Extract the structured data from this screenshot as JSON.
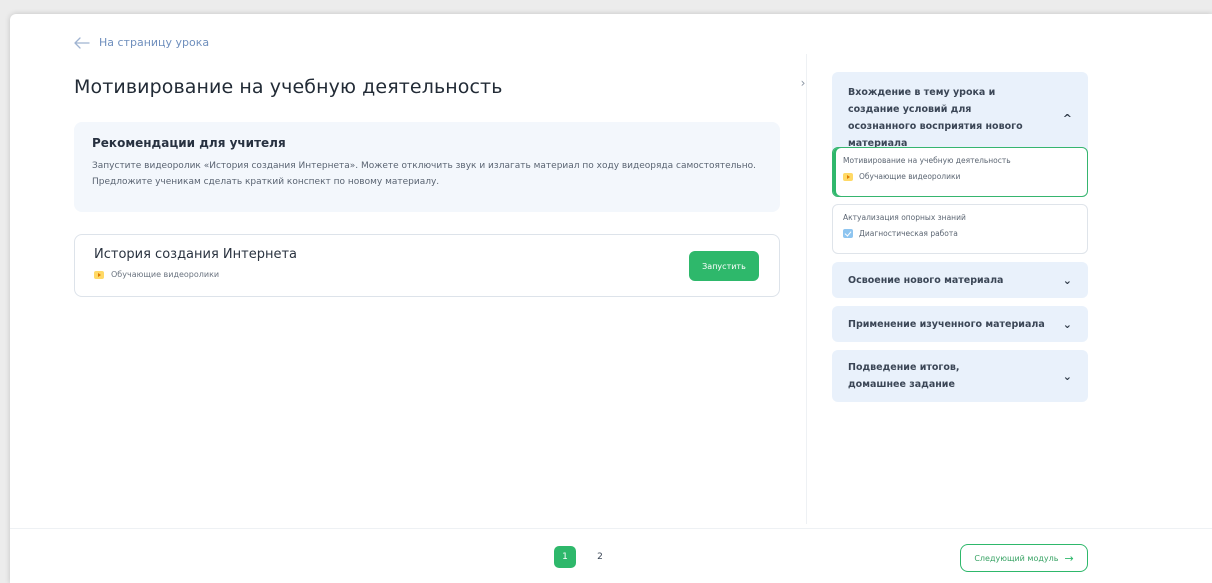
{
  "nav": {
    "back_label": "На страницу урока"
  },
  "page_title": "Мотивирование на учебную деятельность",
  "recommendations": {
    "title": "Рекомендации для учителя",
    "text": "Запустите видеоролик «История создания Интернета». Можете отключить звук и излагать материал по ходу видеоряда самостоятельно. Предложите ученикам сделать краткий конспект по новому материалу."
  },
  "resource": {
    "title": "История создания Интернета",
    "type": "Обучающие видеоролики",
    "type_icon": "video-icon",
    "launch_label": "Запустить"
  },
  "sidebar": {
    "collapse_icon": "chevron-right-icon",
    "sections": [
      {
        "title": "Вхождение в тему урока и создание условий для осознанного восприятия нового материала",
        "expanded": true,
        "items": [
          {
            "title": "Мотивирование на учебную деятельность",
            "type": "Обучающие видеоролики",
            "icon": "video-icon",
            "active": true
          },
          {
            "title": "Актуализация опорных знаний",
            "type": "Диагностическая работа",
            "icon": "diagnostic-icon",
            "active": false
          }
        ]
      },
      {
        "title": "Освоение нового материала",
        "expanded": false
      },
      {
        "title": "Применение изученного материала",
        "expanded": false
      },
      {
        "title": "Подведение итогов, домашнее задание",
        "expanded": false
      }
    ]
  },
  "pagination": {
    "pages": [
      "1",
      "2"
    ],
    "current": "1"
  },
  "next_module_label": "Следующий модуль",
  "colors": {
    "accent": "#2eb86b",
    "section_bg": "#e9f1fb",
    "reco_bg": "#f3f7fc",
    "link": "#6f8fbd"
  }
}
